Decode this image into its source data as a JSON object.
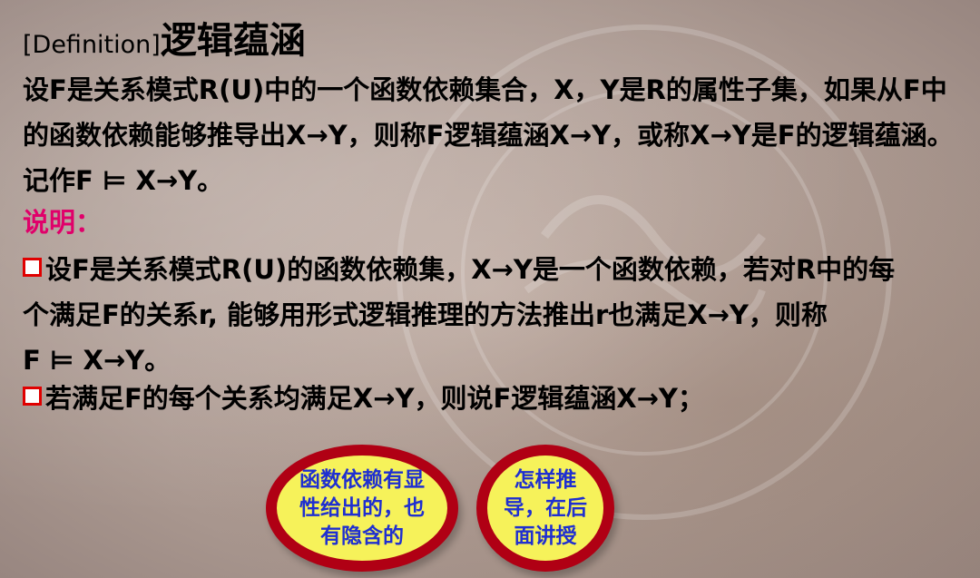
{
  "title": {
    "en": "[Definition]",
    "zh": "逻辑蕴涵"
  },
  "paragraph1": "设F是关系模式R(U)中的一个函数依赖集合，X，Y是R的属性子集，如果从F中的函数依赖能够推导出X→Y，则称F逻辑蕴涵X→Y，或称X→Y是F的逻辑蕴涵。记作F ⊨ X→Y。",
  "note_label": "说明：",
  "bullets": [
    {
      "line1": "设F是关系模式R(U)的函数依赖集，X→Y是一个函数依赖，若对R中的每",
      "line2": "个满足F的关系r, 能够用形式逻辑推理的方法推出r也满足X→Y，则称",
      "line3": "F  ⊨ X→Y。"
    },
    {
      "text": "若满足F的每个关系均满足X→Y，则说F逻辑蕴涵X→Y；"
    }
  ],
  "bubbles": [
    {
      "lines": [
        "函数依赖有显",
        "性给出的，也",
        "有隐含的"
      ]
    },
    {
      "lines": [
        "怎样推",
        "导，在后",
        "面讲授"
      ]
    }
  ],
  "colors": {
    "note": "#e0006a",
    "bullet_border": "#e00000",
    "bubble_fill": "#f6f25a",
    "bubble_border": "#b00014",
    "bubble_text": "#1f2fd0"
  }
}
